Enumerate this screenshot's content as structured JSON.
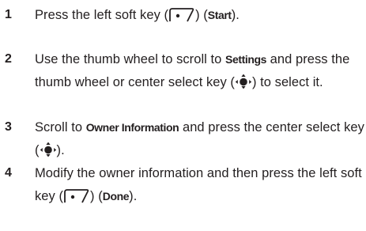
{
  "steps": [
    {
      "number": "1",
      "parts": {
        "t1": "Press the left soft key (",
        "t2": ") (",
        "k1": "Start",
        "t3": ")."
      }
    },
    {
      "number": "2",
      "parts": {
        "t1": "Use the thumb wheel to scroll to ",
        "k1": "Settings",
        "t2": " and press the thumb wheel or center select key (",
        "t3": ") to select it."
      }
    },
    {
      "number": "3",
      "parts": {
        "t1": "Scroll to ",
        "k1": "Owner Information",
        "t2": " and press the center select key (",
        "t3": ")."
      }
    },
    {
      "number": "4",
      "parts": {
        "t1": "Modify the owner information and then press the left soft key (",
        "t2": ") (",
        "k1": "Done",
        "t3": ")."
      }
    }
  ],
  "icons": {
    "soft_key": "left-soft-key-icon",
    "center_select": "center-select-key-icon"
  }
}
